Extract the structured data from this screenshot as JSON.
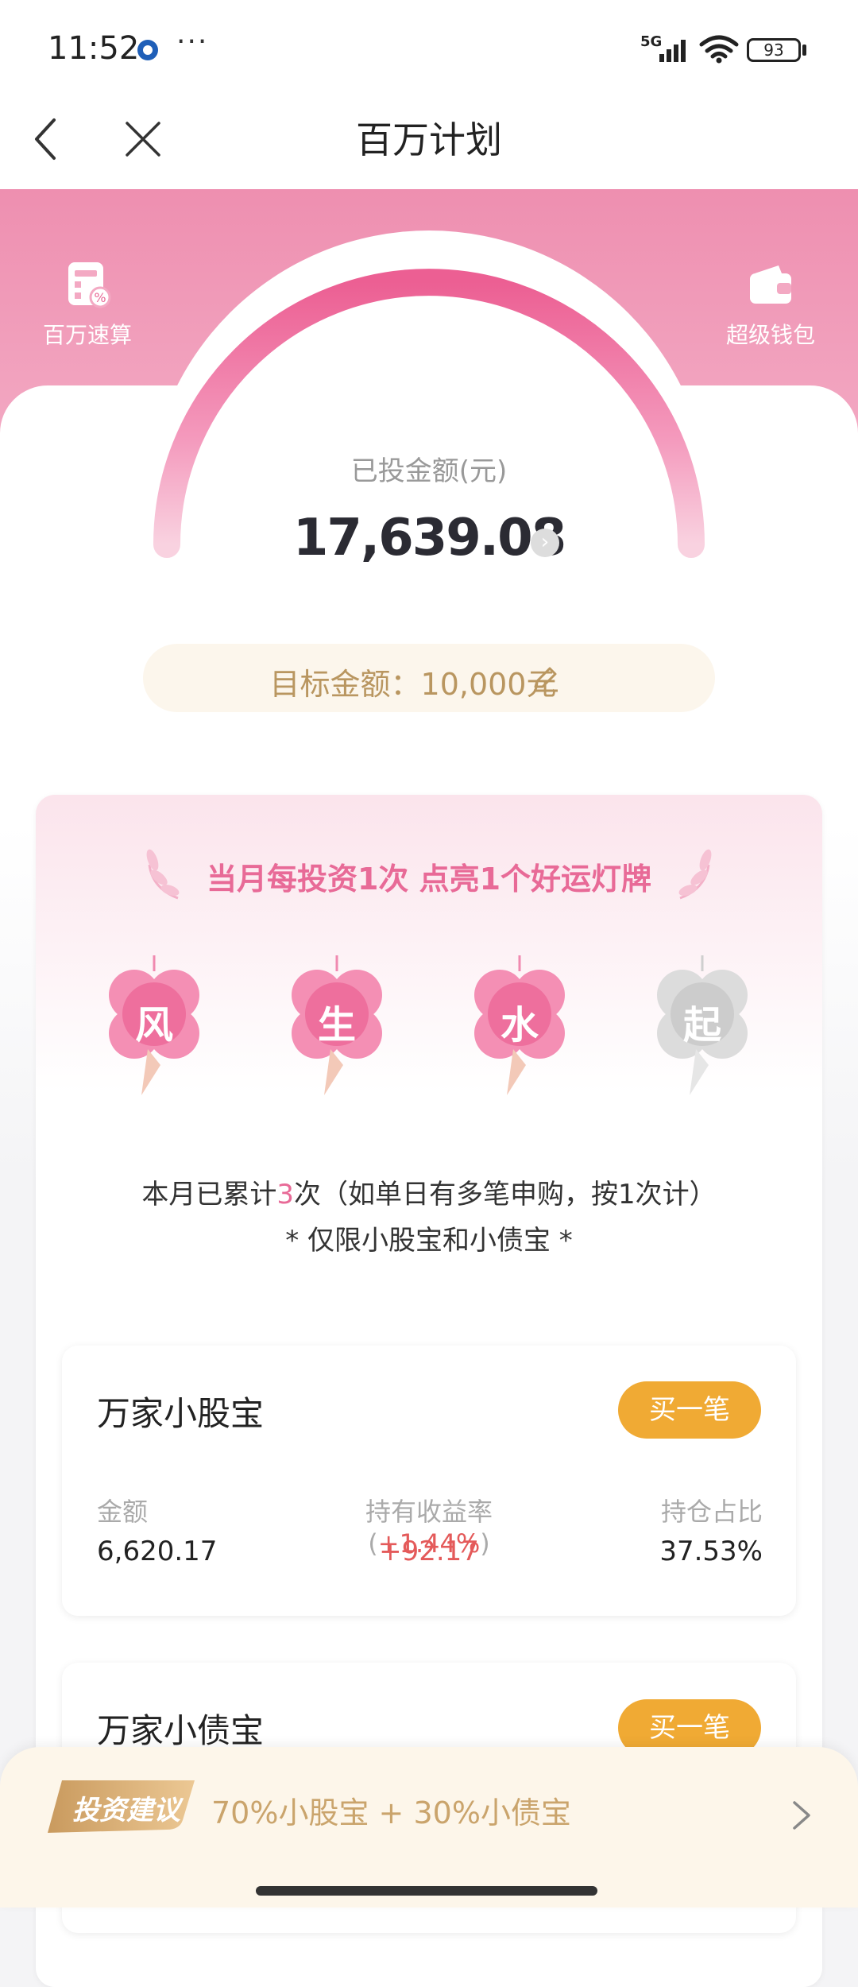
{
  "status_bar": {
    "time": "11:52",
    "dots": "···",
    "network": "5G",
    "battery": "93"
  },
  "nav": {
    "title": "百万计划",
    "back_icon": "chevron-left-icon",
    "close_icon": "close-icon"
  },
  "hero": {
    "left_tool": {
      "label": "百万速算",
      "icon": "calculator-icon"
    },
    "right_tool": {
      "label": "超级钱包",
      "icon": "wallet-icon"
    },
    "invested_label": "已投金额(元)",
    "invested_amount": "17,639.08",
    "target_text": "目标金额：10,000元"
  },
  "lanterns": {
    "headline": "当月每投资1次 点亮1个好运灯牌",
    "items": [
      {
        "char": "风",
        "lit": true
      },
      {
        "char": "生",
        "lit": true
      },
      {
        "char": "水",
        "lit": true
      },
      {
        "char": "起",
        "lit": false
      }
    ],
    "count_prefix": "本月已累计",
    "count_value": "3",
    "count_suffix": "次（如单日有多笔申购，按1次计）",
    "note": "* 仅限小股宝和小债宝 *"
  },
  "funds": [
    {
      "name": "万家小股宝",
      "buy_label": "买一笔",
      "amount_label": "金额",
      "amount": "6,620.17",
      "return_label": "持有收益率(",
      "return_rate": "+1.44%",
      "return_close": ")",
      "return_value": "+92.17",
      "ratio_label": "持仓占比",
      "ratio": "37.53%"
    },
    {
      "name": "万家小债宝",
      "buy_label": "买一笔"
    }
  ],
  "bottom": {
    "tag": "投资建议",
    "advice": "70%小股宝 + 30%小债宝"
  },
  "colors": {
    "pink_accent": "#e86a97",
    "hero_pink": "#ee8fb0",
    "buy_orange": "#f0aa34",
    "gain_red": "#e45a5a",
    "gold_text": "#b99660"
  }
}
